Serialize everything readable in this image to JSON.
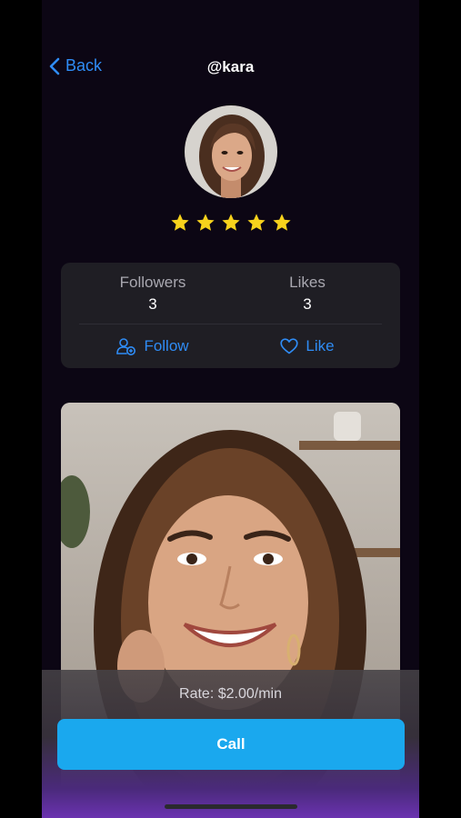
{
  "header": {
    "back_label": "Back",
    "title": "@kara"
  },
  "profile": {
    "rating_stars": 5,
    "star_color": "#f7d21c"
  },
  "stats": {
    "followers_label": "Followers",
    "followers_value": "3",
    "likes_label": "Likes",
    "likes_value": "3"
  },
  "actions": {
    "follow_label": "Follow",
    "like_label": "Like"
  },
  "call_panel": {
    "rate_text": "Rate: $2.00/min",
    "call_label": "Call"
  },
  "colors": {
    "accent": "#2f8cf5",
    "call_button": "#1aa8ee",
    "background": "#0c0614"
  }
}
